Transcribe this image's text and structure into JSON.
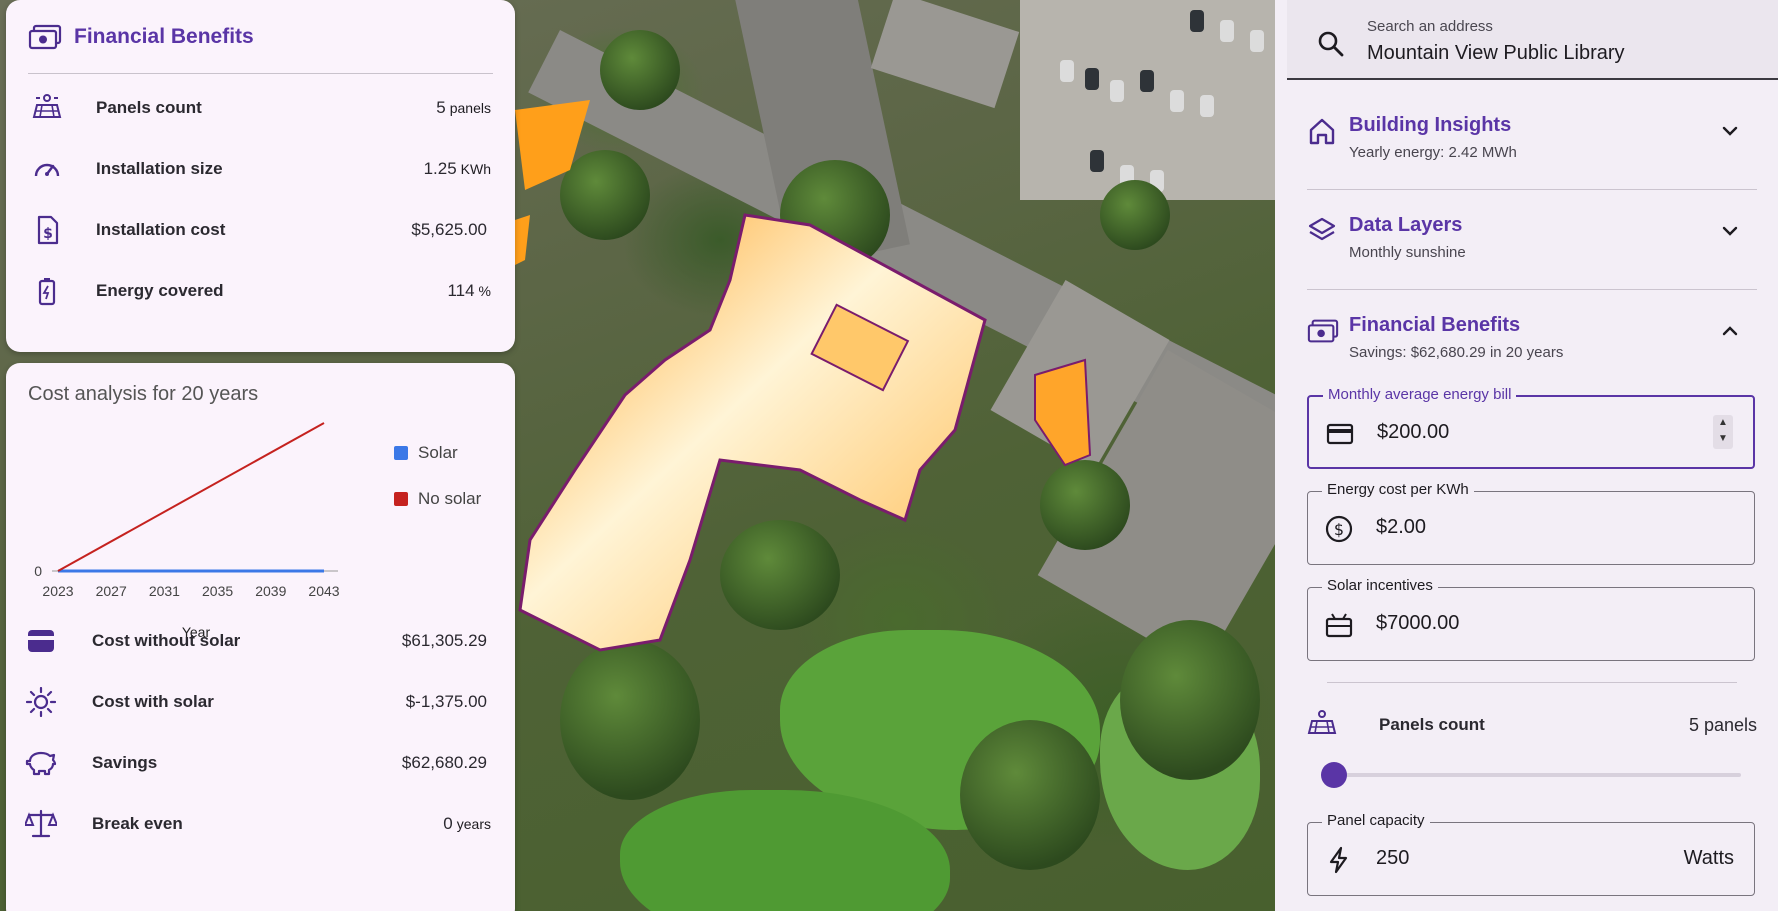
{
  "left_summary": {
    "title": "Financial Benefits",
    "rows": [
      {
        "icon": "solar-panel-icon",
        "label": "Panels count",
        "value": "5",
        "unit": "panels"
      },
      {
        "icon": "speedometer-icon",
        "label": "Installation size",
        "value": "1.25",
        "unit": "KWh"
      },
      {
        "icon": "invoice-dollar-icon",
        "label": "Installation cost",
        "value": "$5,625.00",
        "unit": ""
      },
      {
        "icon": "battery-charging-icon",
        "label": "Energy covered",
        "value": "114",
        "unit": "%"
      }
    ]
  },
  "cost_analysis": {
    "title": "Cost analysis for 20 years",
    "rows": [
      {
        "icon": "wallet-icon",
        "label": "Cost without solar",
        "value": "$61,305.29",
        "unit": ""
      },
      {
        "icon": "sun-icon",
        "label": "Cost with solar",
        "value": "$-1,375.00",
        "unit": ""
      },
      {
        "icon": "piggy-bank-icon",
        "label": "Savings",
        "value": "$62,680.29",
        "unit": ""
      },
      {
        "icon": "scale-icon",
        "label": "Break even",
        "value": "0",
        "unit": "years"
      }
    ]
  },
  "chart_data": {
    "type": "line",
    "title": "Cost analysis for 20 years",
    "xlabel": "Year",
    "ylabel": "",
    "x_ticks": [
      "2023",
      "2027",
      "2031",
      "2035",
      "2039",
      "2043"
    ],
    "y_ticks": [
      "0"
    ],
    "x": [
      2023,
      2043
    ],
    "series": [
      {
        "name": "Solar",
        "color": "#3b78e7",
        "values": [
          0,
          0
        ]
      },
      {
        "name": "No solar",
        "color": "#c5221f",
        "values": [
          0,
          61305.29
        ]
      }
    ],
    "legend_position": "right"
  },
  "search": {
    "placeholder": "Search an address",
    "value": "Mountain View Public Library"
  },
  "sections": [
    {
      "icon": "home-icon",
      "title": "Building Insights",
      "subtitle": "Yearly energy: 2.42 MWh",
      "expanded": false
    },
    {
      "icon": "layers-icon",
      "title": "Data Layers",
      "subtitle": "Monthly sunshine",
      "expanded": false
    },
    {
      "icon": "money-icon",
      "title": "Financial Benefits",
      "subtitle": "Savings: $62,680.29 in 20 years",
      "expanded": true
    }
  ],
  "fields": {
    "monthly_bill": {
      "label": "Monthly average energy bill",
      "prefix": "$",
      "value": "200.00"
    },
    "energy_cost": {
      "label": "Energy cost per KWh",
      "prefix": "$",
      "value": "2.00"
    },
    "incentives": {
      "label": "Solar incentives",
      "prefix": "$",
      "value": "7000.00"
    },
    "panel_capacity": {
      "label": "Panel capacity",
      "value": "250",
      "suffix": "Watts"
    }
  },
  "panels_slider": {
    "label": "Panels count",
    "value_text": "5 panels",
    "level": 0
  },
  "colors": {
    "accent": "#5a35a6",
    "card_bg": "#fbf3fc",
    "panel_bg": "#f3eef6"
  }
}
